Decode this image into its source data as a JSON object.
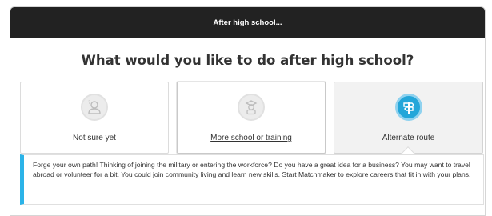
{
  "header": {
    "title": "After high school..."
  },
  "question": "What would you like to do after high school?",
  "options": [
    {
      "label": "Not sure yet",
      "icon": "person-question-icon",
      "selected": false
    },
    {
      "label": "More school or training",
      "icon": "graduate-icon",
      "selected": false
    },
    {
      "label": "Alternate route",
      "icon": "signpost-icon",
      "selected": true
    }
  ],
  "description": "Forge your own path! Thinking of joining the military or entering the workforce? Do you have a great idea for a business? You may want to travel abroad or volunteer for a bit. You could join community living and learn new skills. Start Matchmaker to explore careers that fit in with your plans.",
  "colors": {
    "accent": "#24a6d9",
    "header_bg": "#222222"
  }
}
